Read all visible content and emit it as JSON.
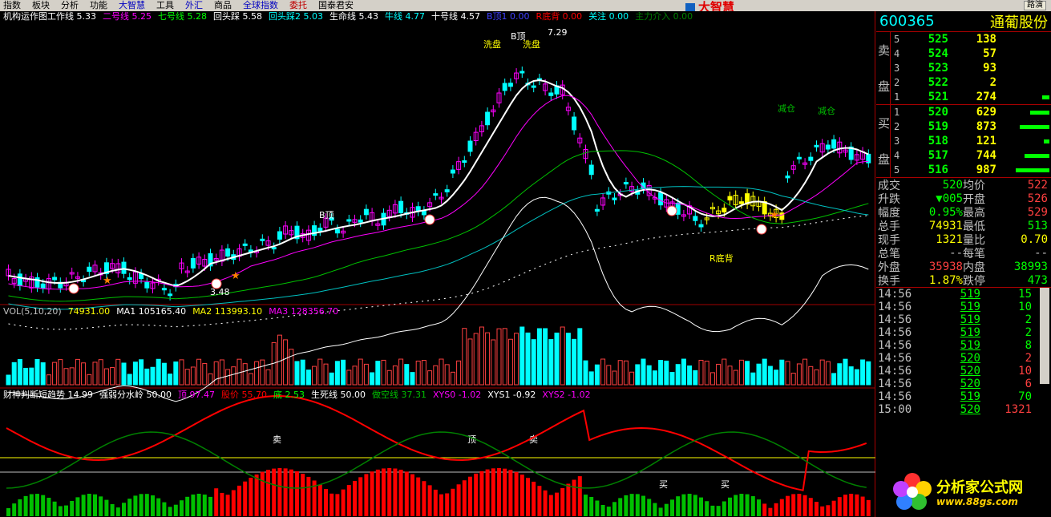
{
  "menu": [
    {
      "label": "指数",
      "color": "black"
    },
    {
      "label": "板块",
      "color": "black"
    },
    {
      "label": "分析",
      "color": "black"
    },
    {
      "label": "功能",
      "color": "black"
    },
    {
      "label": "大智慧",
      "color": "blue"
    },
    {
      "label": "工具",
      "color": "black"
    },
    {
      "label": "外汇",
      "color": "blue"
    },
    {
      "label": "商品",
      "color": "black"
    },
    {
      "label": "全球指数",
      "color": "blue"
    },
    {
      "label": "委托",
      "color": "red"
    },
    {
      "label": "国泰君安",
      "color": "black"
    }
  ],
  "app_logo": "大智慧",
  "route_button": "路演",
  "main_legend": [
    {
      "text": "机构运作图工作线 5.33",
      "color": "#ffffff"
    },
    {
      "text": "二号线 5.25",
      "color": "#ff00ff"
    },
    {
      "text": "七号线 5.28",
      "color": "#00ff00"
    },
    {
      "text": "回头踩 5.58",
      "color": "#ffffff"
    },
    {
      "text": "回头踩2 5.03",
      "color": "#00ffff"
    },
    {
      "text": "生命线 5.43",
      "color": "#ffffff"
    },
    {
      "text": "牛线 4.77",
      "color": "#00ffff"
    },
    {
      "text": "十号线 4.57",
      "color": "#ffffff"
    },
    {
      "text": "B顶1 0.00",
      "color": "#4040ff"
    },
    {
      "text": "R底背 0.00",
      "color": "#ff0000"
    },
    {
      "text": "关注 0.00",
      "color": "#00ffff"
    },
    {
      "text": "主力介入 0.00",
      "color": "#008000"
    }
  ],
  "vol_legend": [
    {
      "text": "VOL(5,10,20)",
      "color": "#c0c0c0"
    },
    {
      "text": "74931.00",
      "color": "#ffff00"
    },
    {
      "text": "MA1 105165.40",
      "color": "#ffffff"
    },
    {
      "text": "MA2 113993.10",
      "color": "#ffff00"
    },
    {
      "text": "MA3 128356.70",
      "color": "#ff00ff"
    }
  ],
  "ind_legend": [
    {
      "text": "财神判断短趋势 14.99",
      "color": "#ffffff"
    },
    {
      "text": "强弱分水岭 50.00",
      "color": "#ffffff"
    },
    {
      "text": "顶 97.47",
      "color": "#ff00ff"
    },
    {
      "text": "股价 55.70",
      "color": "#ff0000"
    },
    {
      "text": "底 2.53",
      "color": "#00ff00"
    },
    {
      "text": "生死线 50.00",
      "color": "#ffffff"
    },
    {
      "text": "做空线 37.31",
      "color": "#00c000"
    },
    {
      "text": "XYS0 -1.02",
      "color": "#ff00ff"
    },
    {
      "text": "XYS1 -0.92",
      "color": "#ffffff"
    },
    {
      "text": "XYS2 -1.02",
      "color": "#ff00ff"
    }
  ],
  "chart_labels": {
    "high": "7.29",
    "low": "3.48",
    "wash1": "洗盘",
    "wash2": "洗盘",
    "btop": "B顶",
    "btop2": "B顶",
    "rdibei": "R底背",
    "reduce1": "减仓",
    "reduce2": "减仓",
    "sell": "卖",
    "sell2": "卖",
    "top": "顶",
    "buy1": "买",
    "buy2": "买"
  },
  "stock": {
    "code": "600365",
    "name": "通葡股份"
  },
  "sell_side_label": [
    "卖",
    "盘"
  ],
  "buy_side_label": [
    "买",
    "盘"
  ],
  "asks": [
    {
      "level": "5",
      "price": "525",
      "volume": "138",
      "bar": 0
    },
    {
      "level": "4",
      "price": "524",
      "volume": "57",
      "bar": 0
    },
    {
      "level": "3",
      "price": "523",
      "volume": "93",
      "bar": 0
    },
    {
      "level": "2",
      "price": "522",
      "volume": "2",
      "bar": 0
    },
    {
      "level": "1",
      "price": "521",
      "volume": "274",
      "bar": 0.2
    }
  ],
  "bids": [
    {
      "level": "1",
      "price": "520",
      "volume": "629",
      "bar": 0.55
    },
    {
      "level": "2",
      "price": "519",
      "volume": "873",
      "bar": 0.85
    },
    {
      "level": "3",
      "price": "518",
      "volume": "121",
      "bar": 0.15
    },
    {
      "level": "4",
      "price": "517",
      "volume": "744",
      "bar": 0.7
    },
    {
      "level": "5",
      "price": "516",
      "volume": "987",
      "bar": 0.95
    }
  ],
  "stats": [
    {
      "l1": "成交",
      "v1": "520",
      "c1": "#00ff00",
      "l2": "均价",
      "v2": "522",
      "c2": "#ff4040"
    },
    {
      "l1": "升跌",
      "v1": "▼005",
      "c1": "#00ff00",
      "l2": "开盘",
      "v2": "526",
      "c2": "#ff4040"
    },
    {
      "l1": "幅度",
      "v1": "0.95%",
      "c1": "#00ff00",
      "l2": "最高",
      "v2": "529",
      "c2": "#ff4040"
    },
    {
      "l1": "总手",
      "v1": "74931",
      "c1": "#ffff00",
      "l2": "最低",
      "v2": "513",
      "c2": "#00ff00"
    },
    {
      "l1": "现手",
      "v1": "1321",
      "c1": "#ffff00",
      "l2": "量比",
      "v2": "0.70",
      "c2": "#ffff00"
    },
    {
      "l1": "总笔",
      "v1": "--",
      "c1": "#c0c0c0",
      "l2": "每笔",
      "v2": "--",
      "c2": "#c0c0c0"
    },
    {
      "l1": "外盘",
      "v1": "35938",
      "c1": "#ff4040",
      "l2": "内盘",
      "v2": "38993",
      "c2": "#00ff00"
    },
    {
      "l1": "换手",
      "v1": "1.87%",
      "c1": "#ffff00",
      "l2": "跌停",
      "v2": "473",
      "c2": "#00ff00"
    }
  ],
  "ticks": [
    {
      "time": "14:56",
      "price": "519",
      "volume": "15",
      "vcolor": "#00ff00"
    },
    {
      "time": "14:56",
      "price": "519",
      "volume": "10",
      "vcolor": "#00ff00"
    },
    {
      "time": "14:56",
      "price": "519",
      "volume": "2",
      "vcolor": "#00ff00"
    },
    {
      "time": "14:56",
      "price": "519",
      "volume": "2",
      "vcolor": "#00ff00"
    },
    {
      "time": "14:56",
      "price": "519",
      "volume": "8",
      "vcolor": "#00ff00"
    },
    {
      "time": "14:56",
      "price": "520",
      "volume": "2",
      "vcolor": "#ff4040"
    },
    {
      "time": "14:56",
      "price": "520",
      "volume": "10",
      "vcolor": "#ff4040"
    },
    {
      "time": "14:56",
      "price": "520",
      "volume": "6",
      "vcolor": "#ff4040"
    },
    {
      "time": "14:56",
      "price": "519",
      "volume": "70",
      "vcolor": "#00ff00"
    },
    {
      "time": "15:00",
      "price": "520",
      "volume": "1321",
      "vcolor": "#ff4040"
    }
  ],
  "watermark": {
    "title": "分析家公式网",
    "url": "www.88gs.com"
  }
}
